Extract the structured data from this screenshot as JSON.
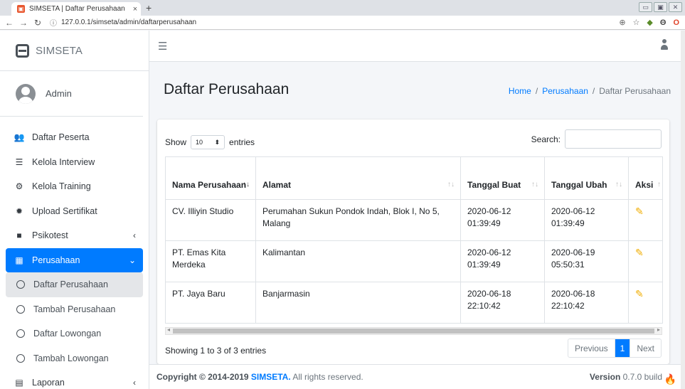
{
  "browser": {
    "tab_title": "SIMSETA | Daftar Perusahaan",
    "tab_close": "×",
    "new_tab": "+",
    "url": "127.0.0.1/simseta/admin/daftarperusahaan",
    "window_controls": [
      "▭",
      "▣",
      "✕"
    ]
  },
  "sidebar": {
    "brand": "SIMSETA",
    "user_name": "Admin",
    "items": [
      {
        "label": "Daftar Peserta",
        "icon": "users-icon"
      },
      {
        "label": "Kelola Interview",
        "icon": "list-icon"
      },
      {
        "label": "Kelola Training",
        "icon": "cogs-icon"
      },
      {
        "label": "Upload Sertifikat",
        "icon": "certificate-icon"
      },
      {
        "label": "Psikotest",
        "icon": "book-icon"
      },
      {
        "label": "Perusahaan",
        "icon": "building-icon"
      },
      {
        "label": "Daftar Perusahaan",
        "icon": "circle-icon"
      },
      {
        "label": "Tambah Perusahaan",
        "icon": "circle-icon"
      },
      {
        "label": "Daftar Lowongan",
        "icon": "circle-icon"
      },
      {
        "label": "Tambah Lowongan",
        "icon": "circle-icon"
      },
      {
        "label": "Laporan",
        "icon": "file-icon"
      }
    ]
  },
  "header": {
    "title": "Daftar Perusahaan",
    "breadcrumb": {
      "home": "Home",
      "sep": "/",
      "section": "Perusahaan",
      "current": "Daftar Perusahaan"
    }
  },
  "table_controls": {
    "show": "Show",
    "entries_value": "10",
    "entries": "entries",
    "search_label": "Search:",
    "search_value": ""
  },
  "table": {
    "columns": [
      "Nama Perusahaan",
      "Alamat",
      "Tanggal Buat",
      "Tanggal Ubah",
      "Aksi"
    ],
    "rows": [
      [
        "CV. Illiyin Studio",
        "Perumahan Sukun Pondok Indah, Blok I, No 5, Malang",
        "2020-06-12 01:39:49",
        "2020-06-12 01:39:49"
      ],
      [
        "PT. Emas Kita Merdeka",
        "Kalimantan",
        "2020-06-12 01:39:49",
        "2020-06-19 05:50:31"
      ],
      [
        "PT. Jaya Baru",
        "Banjarmasin",
        "2020-06-18 22:10:42",
        "2020-06-18 22:10:42"
      ]
    ]
  },
  "pagination": {
    "info": "Showing 1 to 3 of 3 entries",
    "previous": "Previous",
    "page": "1",
    "next": "Next"
  },
  "footer": {
    "copyright_prefix": "Copyright © 2014-2019 ",
    "brand": "SIMSETA.",
    "suffix": " All rights reserved.",
    "version_label": "Version",
    "version_value": " 0.7.0 build"
  },
  "colors": {
    "primary": "#007bff",
    "sidebar_bg": "#ffffff",
    "edit_icon": "#f0ad00"
  }
}
